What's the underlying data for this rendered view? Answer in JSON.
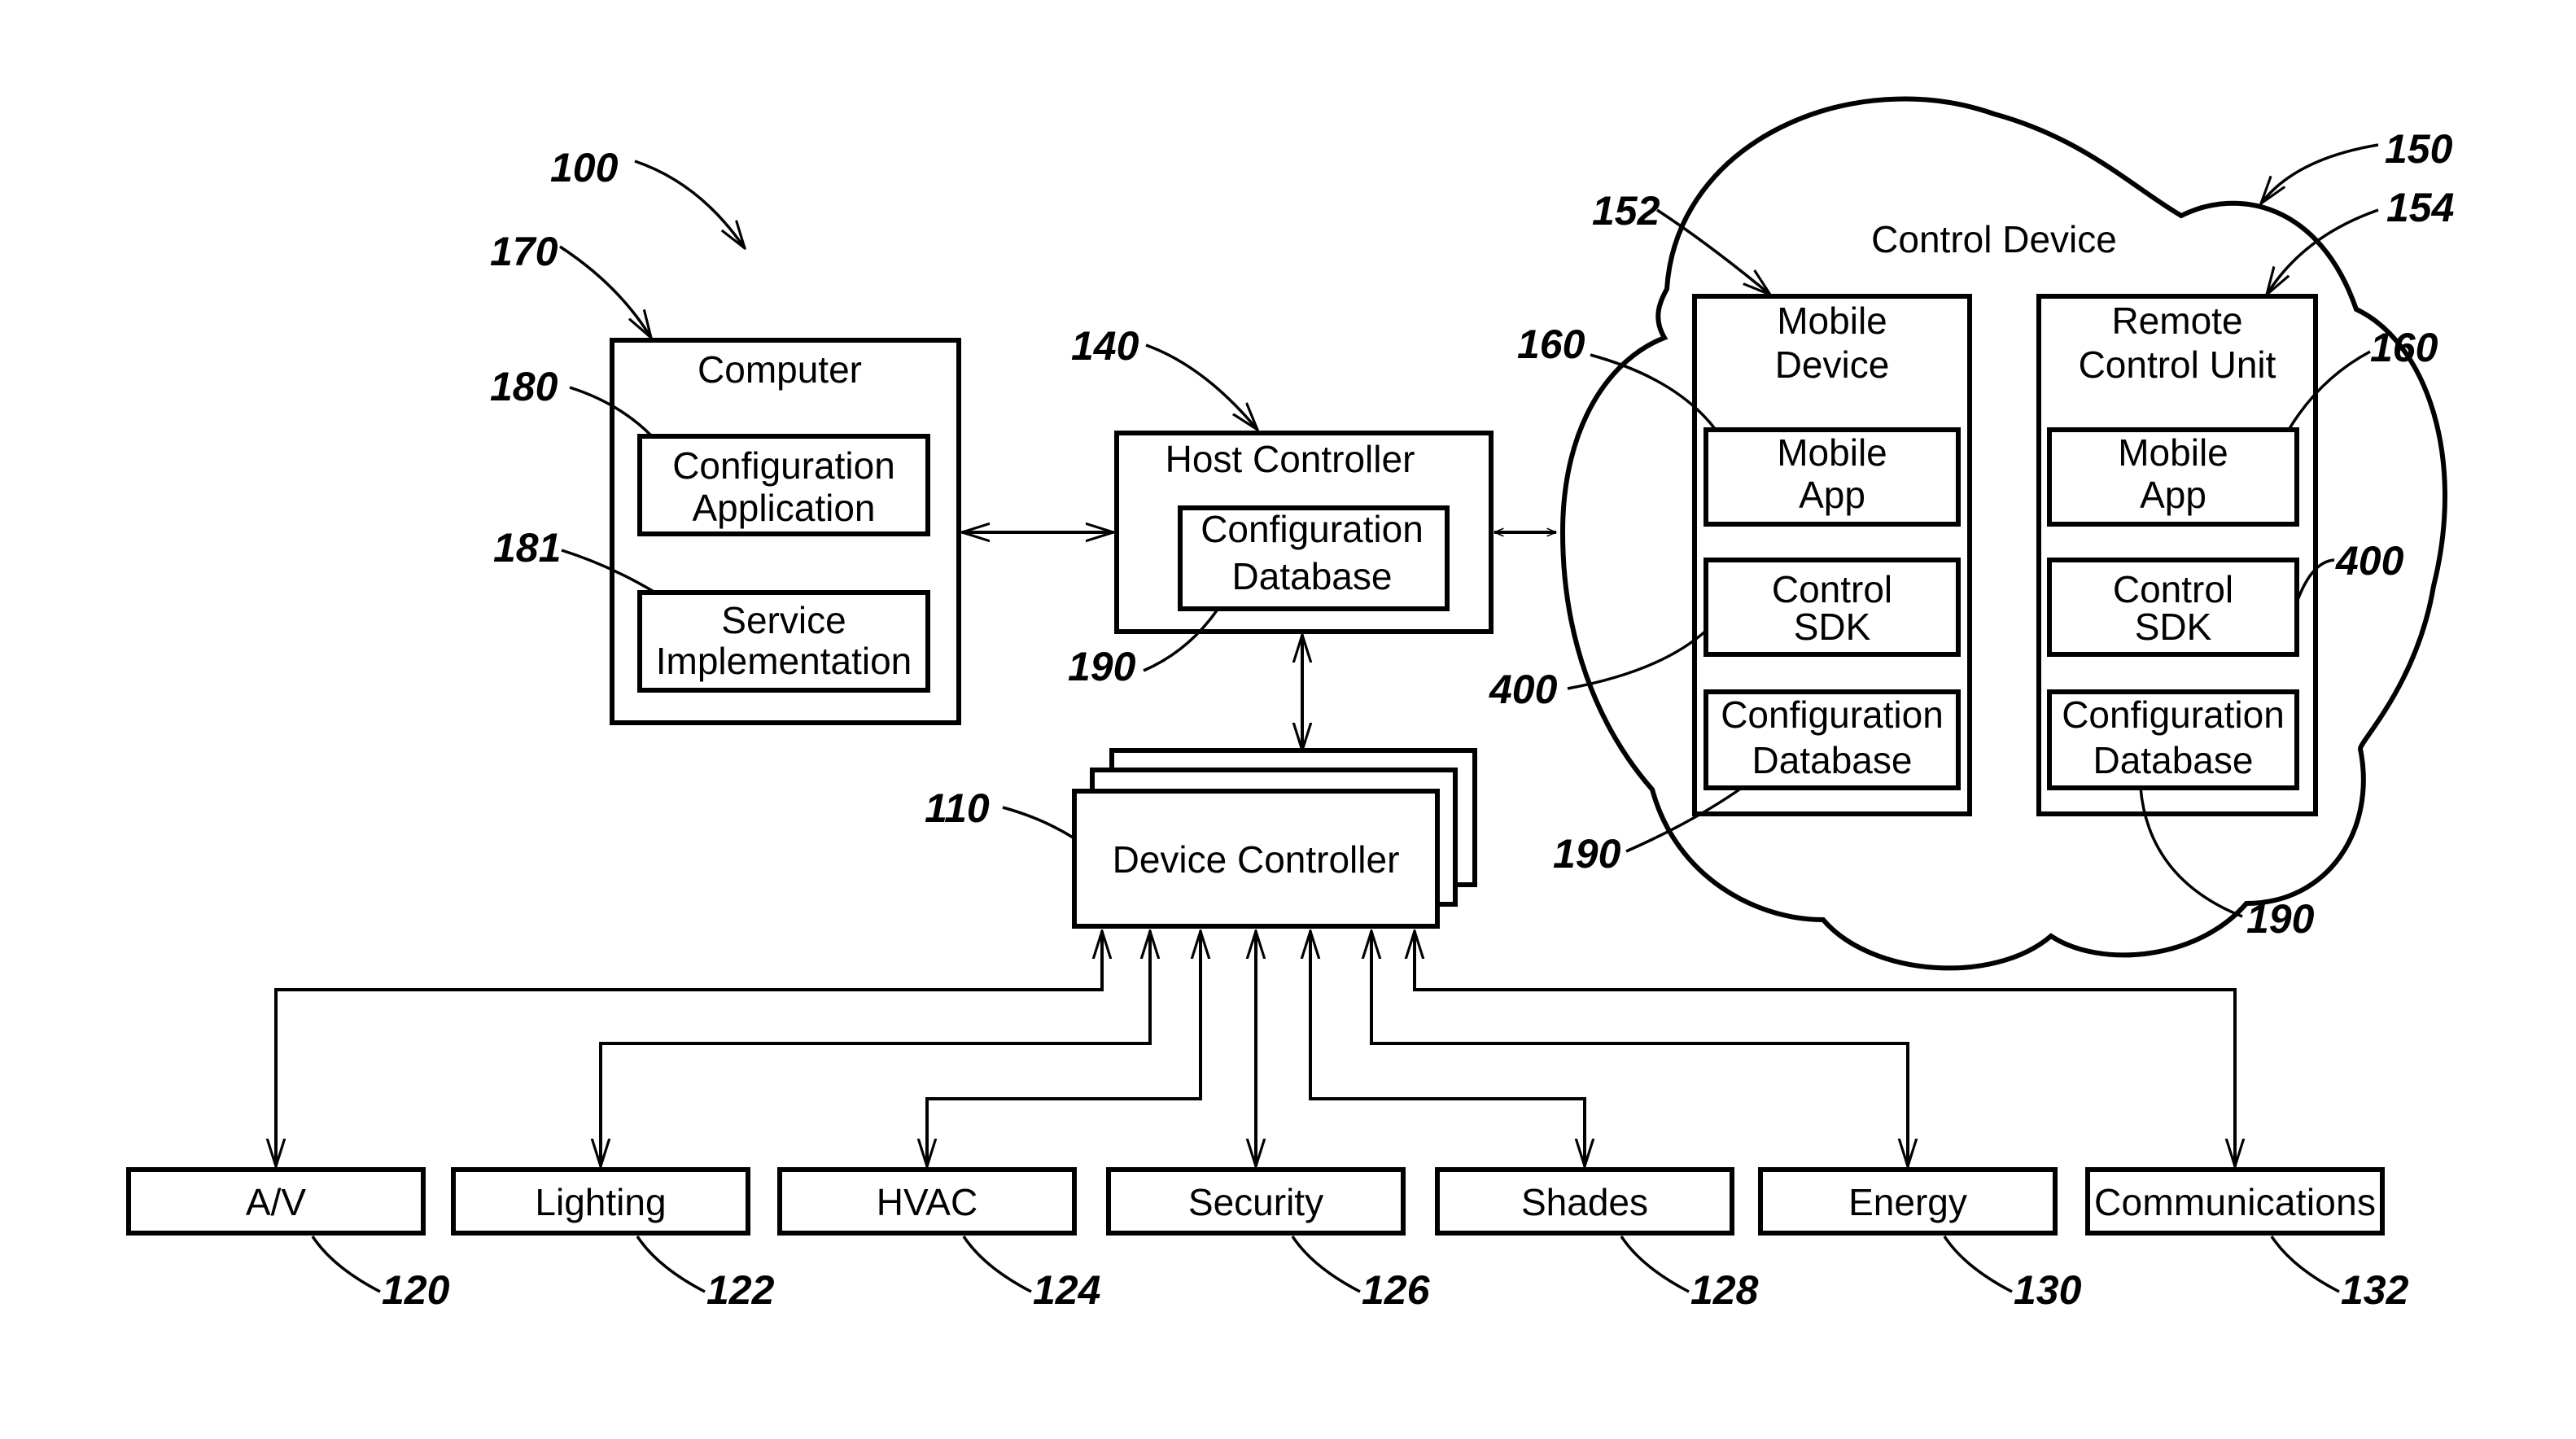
{
  "figure": {
    "system_ref": "100",
    "computer": {
      "ref": "170",
      "title": "Computer",
      "config_app": {
        "ref": "180",
        "line1": "Configuration",
        "line2": "Application"
      },
      "service_impl": {
        "ref": "181",
        "line1": "Service",
        "line2": "Implementation"
      }
    },
    "host_controller": {
      "ref": "140",
      "title": "Host Controller",
      "config_db": {
        "ref": "190",
        "line1": "Configuration",
        "line2": "Database"
      }
    },
    "device_controller": {
      "ref": "110",
      "title": "Device Controller"
    },
    "control_device": {
      "ref": "150",
      "title": "Control Device",
      "mobile_device": {
        "ref": "152",
        "line1": "Mobile",
        "line2": "Device",
        "mobile_app": {
          "ref": "160",
          "line1": "Mobile",
          "line2": "App"
        },
        "control_sdk": {
          "ref": "400",
          "line1": "Control",
          "line2": "SDK"
        },
        "config_db": {
          "ref": "190",
          "line1": "Configuration",
          "line2": "Database"
        }
      },
      "remote_control_unit": {
        "ref": "154",
        "line1": "Remote",
        "line2": "Control Unit",
        "mobile_app": {
          "ref": "160",
          "line1": "Mobile",
          "line2": "App"
        },
        "control_sdk": {
          "ref": "400",
          "line1": "Control",
          "line2": "SDK"
        },
        "config_db": {
          "ref": "190",
          "line1": "Configuration",
          "line2": "Database"
        }
      }
    },
    "devices": [
      {
        "label": "A/V",
        "ref": "120"
      },
      {
        "label": "Lighting",
        "ref": "122"
      },
      {
        "label": "HVAC",
        "ref": "124"
      },
      {
        "label": "Security",
        "ref": "126"
      },
      {
        "label": "Shades",
        "ref": "128"
      },
      {
        "label": "Energy",
        "ref": "130"
      },
      {
        "label": "Communications",
        "ref": "132"
      }
    ]
  }
}
